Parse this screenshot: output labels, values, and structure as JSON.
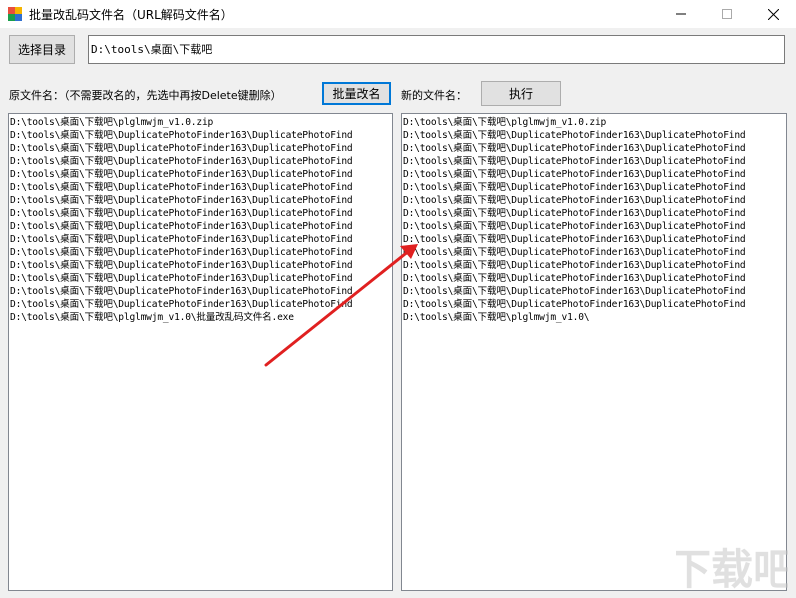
{
  "window": {
    "title": "批量改乱码文件名（URL解码文件名）",
    "controls": [
      "minimize-icon",
      "maximize-icon",
      "close-icon"
    ]
  },
  "toolbar": {
    "select_dir_label": "选择目录",
    "path_value": "D:\\tools\\桌面\\下载吧"
  },
  "labels": {
    "original_label": "原文件名：（不需要改名的，先选中再按Delete键删除）",
    "batch_rename_label": "批量改名",
    "new_label": "新的文件名：",
    "execute_label": "执行"
  },
  "original_files": [
    "D:\\tools\\桌面\\下载吧\\plglmwjm_v1.0.zip",
    "D:\\tools\\桌面\\下载吧\\DuplicatePhotoFinder163\\DuplicatePhotoFind",
    "D:\\tools\\桌面\\下载吧\\DuplicatePhotoFinder163\\DuplicatePhotoFind",
    "D:\\tools\\桌面\\下载吧\\DuplicatePhotoFinder163\\DuplicatePhotoFind",
    "D:\\tools\\桌面\\下载吧\\DuplicatePhotoFinder163\\DuplicatePhotoFind",
    "D:\\tools\\桌面\\下载吧\\DuplicatePhotoFinder163\\DuplicatePhotoFind",
    "D:\\tools\\桌面\\下载吧\\DuplicatePhotoFinder163\\DuplicatePhotoFind",
    "D:\\tools\\桌面\\下载吧\\DuplicatePhotoFinder163\\DuplicatePhotoFind",
    "D:\\tools\\桌面\\下载吧\\DuplicatePhotoFinder163\\DuplicatePhotoFind",
    "D:\\tools\\桌面\\下载吧\\DuplicatePhotoFinder163\\DuplicatePhotoFind",
    "D:\\tools\\桌面\\下载吧\\DuplicatePhotoFinder163\\DuplicatePhotoFind",
    "D:\\tools\\桌面\\下载吧\\DuplicatePhotoFinder163\\DuplicatePhotoFind",
    "D:\\tools\\桌面\\下载吧\\DuplicatePhotoFinder163\\DuplicatePhotoFind",
    "D:\\tools\\桌面\\下载吧\\DuplicatePhotoFinder163\\DuplicatePhotoFind",
    "D:\\tools\\桌面\\下载吧\\DuplicatePhotoFinder163\\DuplicatePhotoFind",
    "D:\\tools\\桌面\\下载吧\\plglmwjm_v1.0\\批量改乱码文件名.exe"
  ],
  "new_files": [
    "D:\\tools\\桌面\\下载吧\\plglmwjm_v1.0.zip",
    "D:\\tools\\桌面\\下载吧\\DuplicatePhotoFinder163\\DuplicatePhotoFind",
    "D:\\tools\\桌面\\下载吧\\DuplicatePhotoFinder163\\DuplicatePhotoFind",
    "D:\\tools\\桌面\\下载吧\\DuplicatePhotoFinder163\\DuplicatePhotoFind",
    "D:\\tools\\桌面\\下载吧\\DuplicatePhotoFinder163\\DuplicatePhotoFind",
    "D:\\tools\\桌面\\下载吧\\DuplicatePhotoFinder163\\DuplicatePhotoFind",
    "D:\\tools\\桌面\\下载吧\\DuplicatePhotoFinder163\\DuplicatePhotoFind",
    "D:\\tools\\桌面\\下载吧\\DuplicatePhotoFinder163\\DuplicatePhotoFind",
    "D:\\tools\\桌面\\下载吧\\DuplicatePhotoFinder163\\DuplicatePhotoFind",
    "D:\\tools\\桌面\\下载吧\\DuplicatePhotoFinder163\\DuplicatePhotoFind",
    "D:\\tools\\桌面\\下载吧\\DuplicatePhotoFinder163\\DuplicatePhotoFind",
    "D:\\tools\\桌面\\下载吧\\DuplicatePhotoFinder163\\DuplicatePhotoFind",
    "D:\\tools\\桌面\\下载吧\\DuplicatePhotoFinder163\\DuplicatePhotoFind",
    "D:\\tools\\桌面\\下载吧\\DuplicatePhotoFinder163\\DuplicatePhotoFind",
    "D:\\tools\\桌面\\下载吧\\DuplicatePhotoFinder163\\DuplicatePhotoFind",
    "D:\\tools\\桌面\\下载吧\\plglmwjm_v1.0\\"
  ],
  "annotation": {
    "arrow_color": "#e02020"
  },
  "watermark": {
    "text": "下载吧",
    "color": "#c8c8c8"
  },
  "colors": {
    "focus_border": "#0078d7",
    "window_bg": "#f0f0f0"
  }
}
